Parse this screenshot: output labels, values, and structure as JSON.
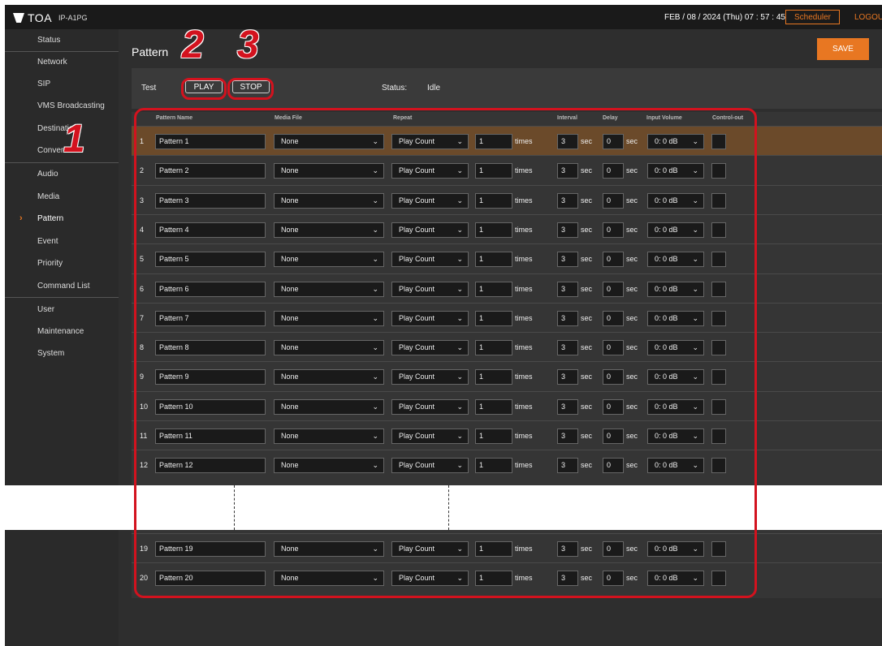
{
  "header": {
    "brand": "TOA",
    "model": "IP-A1PG",
    "datetime": "FEB / 08 / 2024 (Thu)   07 : 57 : 45",
    "scheduler_label": "Scheduler",
    "logout_label": "LOGOUT"
  },
  "sidebar": {
    "items": [
      {
        "label": "Status"
      },
      {
        "label": "Network"
      },
      {
        "label": "SIP"
      },
      {
        "label": "VMS Broadcasting"
      },
      {
        "label": "Destination"
      },
      {
        "label": "Convert"
      },
      {
        "label": "Audio"
      },
      {
        "label": "Media"
      },
      {
        "label": "Pattern",
        "active": true
      },
      {
        "label": "Event"
      },
      {
        "label": "Priority"
      },
      {
        "label": "Command List"
      },
      {
        "label": "User"
      },
      {
        "label": "Maintenance"
      },
      {
        "label": "System"
      }
    ]
  },
  "page": {
    "title": "Pattern",
    "save_label": "SAVE"
  },
  "test": {
    "label": "Test",
    "play_label": "PLAY",
    "stop_label": "STOP",
    "status_label": "Status:",
    "status_value": "Idle"
  },
  "table": {
    "headers": {
      "pattern_name": "Pattern Name",
      "media_file": "Media File",
      "repeat": "Repeat",
      "interval": "Interval",
      "delay": "Delay",
      "input_volume": "Input Volume",
      "control_out": "Control-out"
    },
    "units": {
      "times": "times",
      "sec": "sec"
    },
    "rows": [
      {
        "num": "1",
        "name": "Pattern 1",
        "media": "None",
        "repeat": "Play Count",
        "count": "1",
        "interval": "3",
        "delay": "0",
        "volume": "0: 0 dB",
        "selected": true
      },
      {
        "num": "2",
        "name": "Pattern 2",
        "media": "None",
        "repeat": "Play Count",
        "count": "1",
        "interval": "3",
        "delay": "0",
        "volume": "0: 0 dB"
      },
      {
        "num": "3",
        "name": "Pattern 3",
        "media": "None",
        "repeat": "Play Count",
        "count": "1",
        "interval": "3",
        "delay": "0",
        "volume": "0: 0 dB"
      },
      {
        "num": "4",
        "name": "Pattern 4",
        "media": "None",
        "repeat": "Play Count",
        "count": "1",
        "interval": "3",
        "delay": "0",
        "volume": "0: 0 dB"
      },
      {
        "num": "5",
        "name": "Pattern 5",
        "media": "None",
        "repeat": "Play Count",
        "count": "1",
        "interval": "3",
        "delay": "0",
        "volume": "0: 0 dB"
      },
      {
        "num": "6",
        "name": "Pattern 6",
        "media": "None",
        "repeat": "Play Count",
        "count": "1",
        "interval": "3",
        "delay": "0",
        "volume": "0: 0 dB"
      },
      {
        "num": "7",
        "name": "Pattern 7",
        "media": "None",
        "repeat": "Play Count",
        "count": "1",
        "interval": "3",
        "delay": "0",
        "volume": "0: 0 dB"
      },
      {
        "num": "8",
        "name": "Pattern 8",
        "media": "None",
        "repeat": "Play Count",
        "count": "1",
        "interval": "3",
        "delay": "0",
        "volume": "0: 0 dB"
      },
      {
        "num": "9",
        "name": "Pattern 9",
        "media": "None",
        "repeat": "Play Count",
        "count": "1",
        "interval": "3",
        "delay": "0",
        "volume": "0: 0 dB"
      },
      {
        "num": "10",
        "name": "Pattern 10",
        "media": "None",
        "repeat": "Play Count",
        "count": "1",
        "interval": "3",
        "delay": "0",
        "volume": "0: 0 dB"
      },
      {
        "num": "11",
        "name": "Pattern 11",
        "media": "None",
        "repeat": "Play Count",
        "count": "1",
        "interval": "3",
        "delay": "0",
        "volume": "0: 0 dB"
      },
      {
        "num": "12",
        "name": "Pattern 12",
        "media": "None",
        "repeat": "Play Count",
        "count": "1",
        "interval": "3",
        "delay": "0",
        "volume": "0: 0 dB"
      }
    ],
    "bottom_rows": [
      {
        "num": "19",
        "name": "Pattern 19",
        "media": "None",
        "repeat": "Play Count",
        "count": "1",
        "interval": "3",
        "delay": "0",
        "volume": "0: 0 dB"
      },
      {
        "num": "20",
        "name": "Pattern 20",
        "media": "None",
        "repeat": "Play Count",
        "count": "1",
        "interval": "3",
        "delay": "0",
        "volume": "0: 0 dB"
      }
    ]
  },
  "annotations": {
    "callout_1": "1",
    "callout_2": "2",
    "callout_3": "3",
    "color": "#d3121e"
  },
  "colors": {
    "accent": "#e87722",
    "selected_row": "#6b4a2a"
  }
}
